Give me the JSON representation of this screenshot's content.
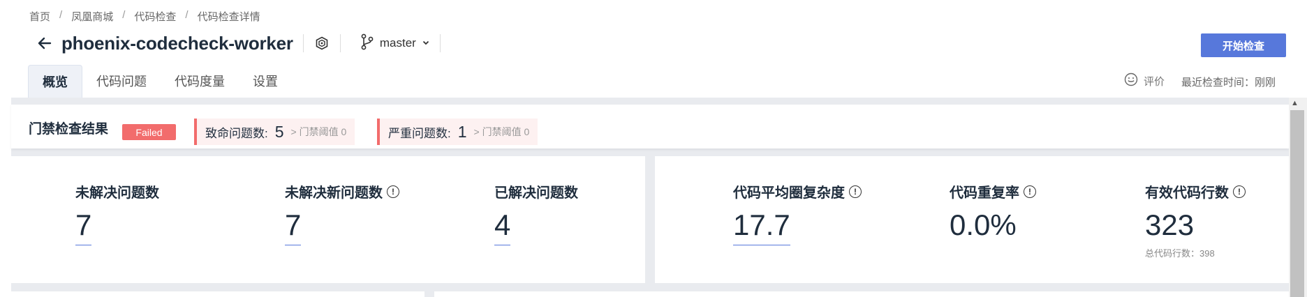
{
  "breadcrumb": [
    "首页",
    "凤凰商城",
    "代码检查",
    "代码检查详情"
  ],
  "header": {
    "repo_title": "phoenix-codecheck-worker",
    "branch": "master",
    "start_button": "开始检查"
  },
  "tabs": [
    {
      "label": "概览",
      "active": true
    },
    {
      "label": "代码问题",
      "active": false
    },
    {
      "label": "代码度量",
      "active": false
    },
    {
      "label": "设置",
      "active": false
    }
  ],
  "rating_label": "评价",
  "last_check": "最近检查时间：刚刚",
  "gate": {
    "title": "门禁检查结果",
    "status": "Failed",
    "items": [
      {
        "label": "致命问题数:",
        "value": "5",
        "threshold": "> 门禁阈值 0"
      },
      {
        "label": "严重问题数:",
        "value": "1",
        "threshold": "> 门禁阈值 0"
      }
    ]
  },
  "metrics_left": [
    {
      "label": "未解决问题数",
      "value": "7",
      "info": false
    },
    {
      "label": "未解决新问题数",
      "value": "7",
      "info": true
    },
    {
      "label": "已解决问题数",
      "value": "4",
      "info": false
    }
  ],
  "metrics_right": [
    {
      "label": "代码平均圈复杂度",
      "value": "17.7",
      "info": true
    },
    {
      "label": "代码重复率",
      "value": "0.0%",
      "info": true
    },
    {
      "label": "有效代码行数",
      "value": "323",
      "info": true,
      "sub": "总代码行数：398"
    }
  ],
  "colors": {
    "accent": "#5778db",
    "danger": "#f26c6c"
  }
}
